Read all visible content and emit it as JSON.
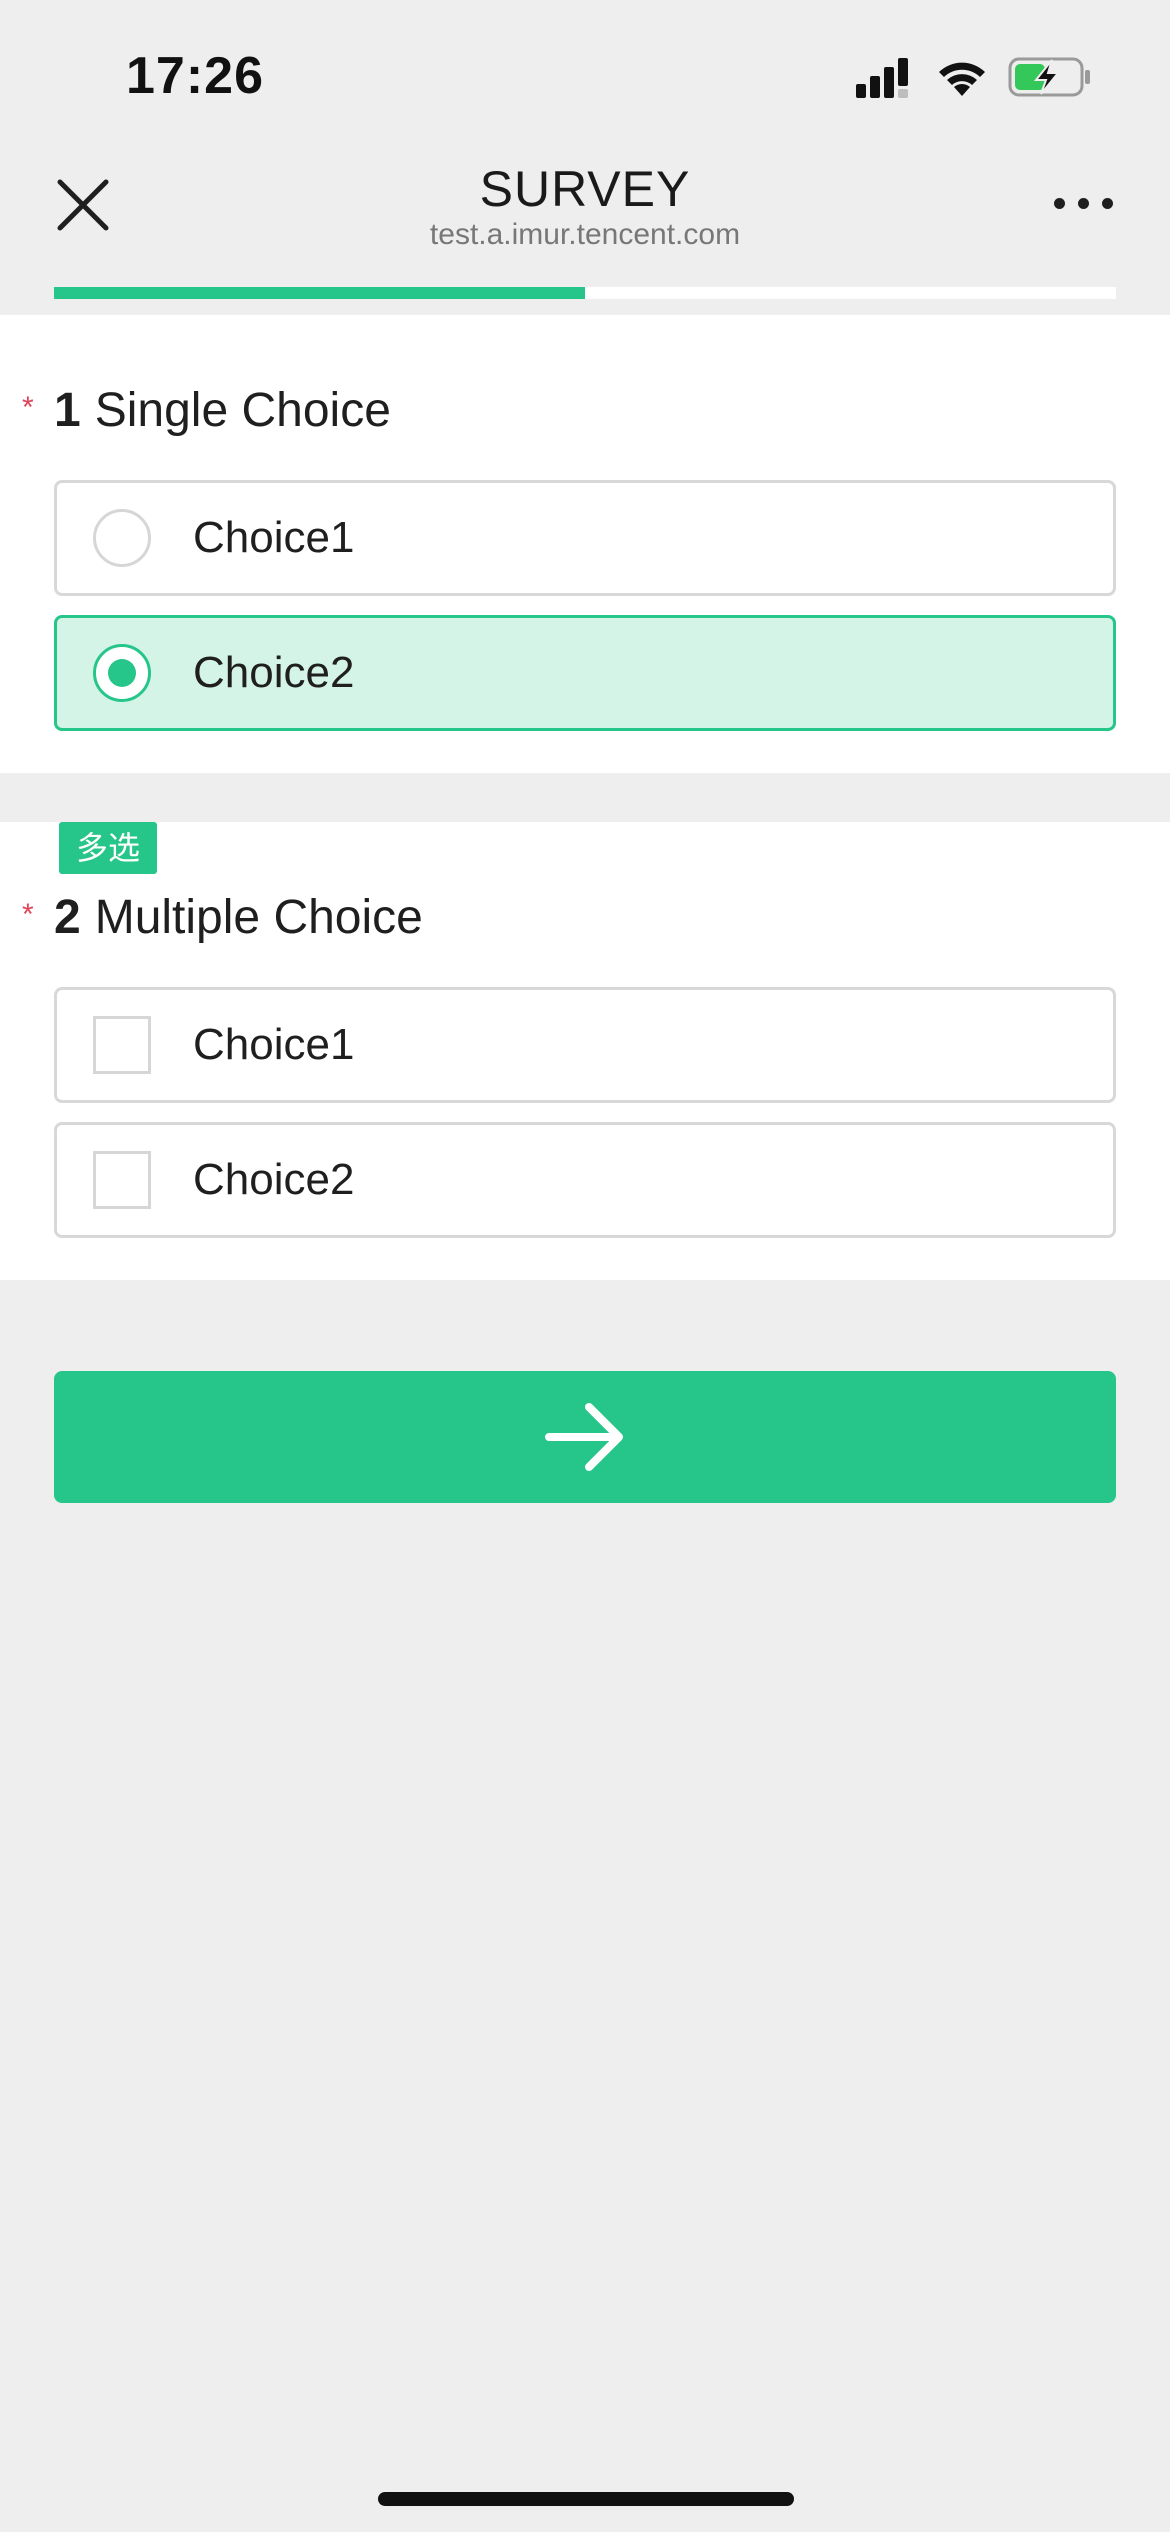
{
  "status_bar": {
    "time": "17:26",
    "icons": [
      "signal-icon",
      "wifi-icon",
      "battery-charging-icon"
    ]
  },
  "header": {
    "title": "SURVEY",
    "subtitle": "test.a.imur.tencent.com",
    "close_icon": "close-icon",
    "more_icon": "more-dots-icon"
  },
  "progress": {
    "fraction": 0.5
  },
  "questions": [
    {
      "number": "1",
      "title": "Single Choice",
      "required_mark": "*",
      "type": "single",
      "options": [
        {
          "label": "Choice1",
          "selected": false
        },
        {
          "label": "Choice2",
          "selected": true
        }
      ]
    },
    {
      "number": "2",
      "title": "Multiple Choice",
      "required_mark": "*",
      "type": "multiple",
      "tag": "多选",
      "options": [
        {
          "label": "Choice1",
          "selected": false
        },
        {
          "label": "Choice2",
          "selected": false
        }
      ]
    }
  ],
  "next_button": {
    "icon": "arrow-right-icon"
  },
  "colors": {
    "accent": "#26c68a",
    "selected_bg": "#d5f4e8",
    "required": "#e0435a",
    "page_bg": "#eeeeee"
  }
}
